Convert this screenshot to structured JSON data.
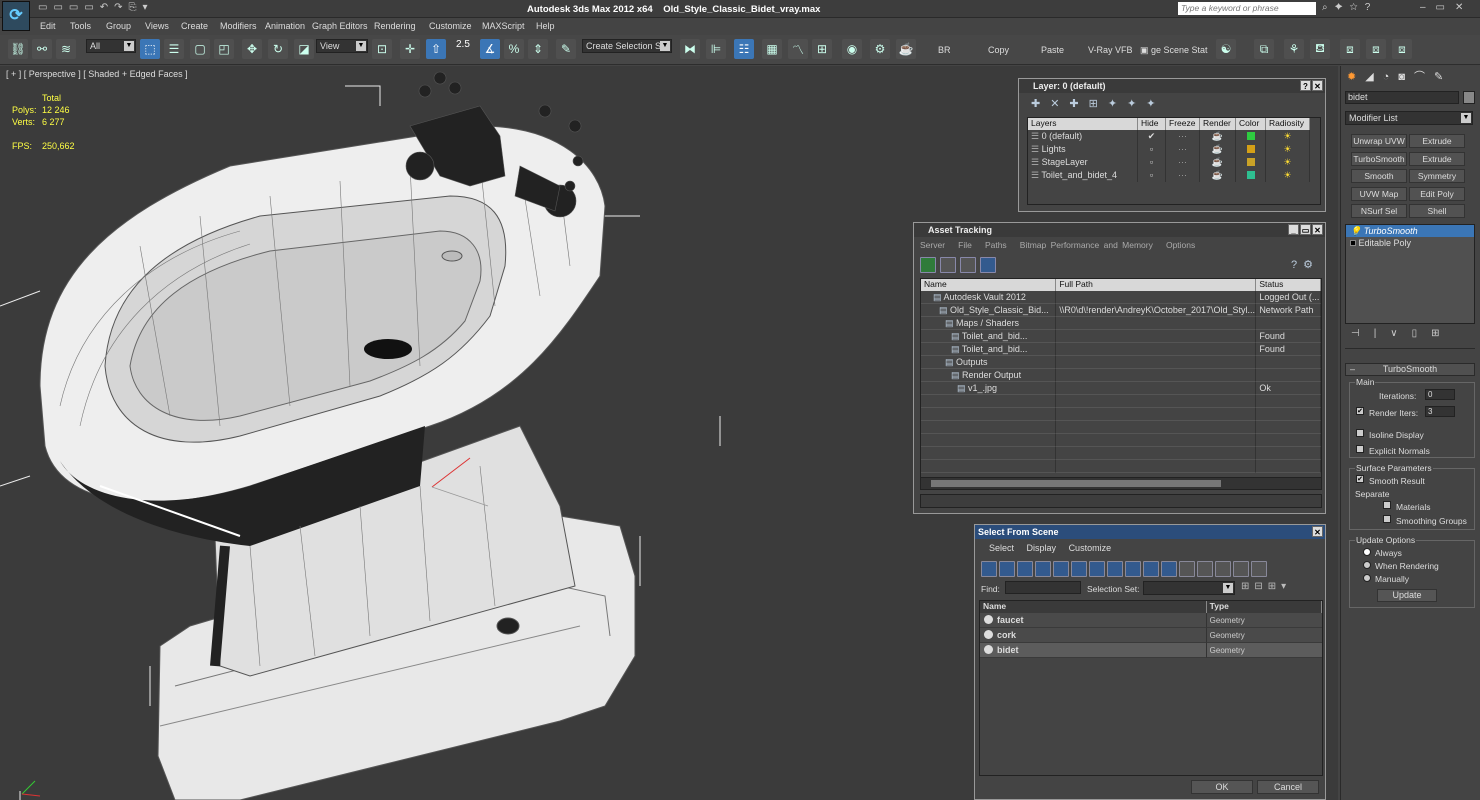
{
  "titlebar": {
    "app": "Autodesk 3ds Max  2012 x64",
    "file": "Old_Style_Classic_Bidet_vray.max",
    "search_placeholder": "Type a keyword or phrase"
  },
  "menu": [
    "Edit",
    "Tools",
    "Group",
    "Views",
    "Create",
    "Modifiers",
    "Animation",
    "Graph Editors",
    "Rendering",
    "Customize",
    "MAXScript",
    "Help"
  ],
  "toolbar": {
    "filter": "All",
    "refcoord": "View",
    "snap": "2.5",
    "selset": "Create Selection Se",
    "br": "BR",
    "copy": "Copy",
    "paste": "Paste",
    "vfb": "V-Ray VFB",
    "scene_state": "ge Scene Stat"
  },
  "viewport": {
    "label": "[ + ] [ Perspective ] [ Shaded + Edged Faces ]",
    "stats": {
      "total": "Total",
      "polys_label": "Polys:",
      "polys": "12 246",
      "verts_label": "Verts:",
      "verts": "6 277",
      "fps_label": "FPS:",
      "fps": "250,662"
    }
  },
  "layer_window": {
    "title": "Layer: 0 (default)",
    "cols": [
      "Layers",
      "Hide",
      "Freeze",
      "Render",
      "Color",
      "Radiosity"
    ],
    "rows": [
      {
        "name": "0 (default)",
        "color": "#2ecc40"
      },
      {
        "name": "Lights",
        "color": "#d4a017"
      },
      {
        "name": "StageLayer",
        "color": "#c9a227"
      },
      {
        "name": "Toilet_and_bidet_4",
        "color": "#2ebf91"
      }
    ]
  },
  "asset_window": {
    "title": "Asset Tracking",
    "menu": [
      "Server",
      "File",
      "Paths",
      "Bitmap Performance and Memory",
      "Options"
    ],
    "cols": [
      "Name",
      "Full Path",
      "Status"
    ],
    "rows": [
      {
        "indent": 2,
        "name": "Autodesk Vault 2012",
        "path": "",
        "status": "Logged Out (..."
      },
      {
        "indent": 3,
        "name": "Old_Style_Classic_Bid...",
        "path": "\\\\R0\\d\\!render\\AndreyK\\October_2017\\Old_Styl...",
        "status": "Network Path"
      },
      {
        "indent": 4,
        "name": "Maps / Shaders",
        "path": "",
        "status": ""
      },
      {
        "indent": 5,
        "name": "Toilet_and_bid...",
        "path": "",
        "status": "Found"
      },
      {
        "indent": 5,
        "name": "Toilet_and_bid...",
        "path": "",
        "status": "Found"
      },
      {
        "indent": 4,
        "name": "Outputs",
        "path": "",
        "status": ""
      },
      {
        "indent": 5,
        "name": "Render Output",
        "path": "",
        "status": ""
      },
      {
        "indent": 6,
        "name": "v1_.jpg",
        "path": "",
        "status": "Ok"
      }
    ]
  },
  "select_window": {
    "title": "Select From Scene",
    "menu": [
      "Select",
      "Display",
      "Customize"
    ],
    "find_label": "Find:",
    "selset_label": "Selection Set:",
    "cols": [
      "Name",
      "Type"
    ],
    "rows": [
      {
        "name": "faucet",
        "type": "Geometry"
      },
      {
        "name": "cork",
        "type": "Geometry"
      },
      {
        "name": "bidet",
        "type": "Geometry"
      }
    ],
    "ok": "OK",
    "cancel": "Cancel"
  },
  "cmd": {
    "objname": "bidet",
    "modlist": "Modifier List",
    "buttons": [
      "Unwrap UVW",
      "Extrude",
      "TurboSmooth",
      "Extrude",
      "Smooth",
      "Symmetry",
      "UVW Map",
      "Edit Poly",
      "NSurf Sel",
      "Shell"
    ],
    "stack": [
      "TurboSmooth",
      "Editable Poly"
    ],
    "rollout_title": "TurboSmooth",
    "main": "Main",
    "iterations_label": "Iterations:",
    "iterations": "0",
    "render_iters_label": "Render Iters:",
    "render_iters": "3",
    "isoline": "Isoline Display",
    "explicit": "Explicit Normals",
    "surface": "Surface Parameters",
    "smooth_result": "Smooth Result",
    "separate": "Separate",
    "materials": "Materials",
    "smoothing": "Smoothing Groups",
    "update_options": "Update Options",
    "always": "Always",
    "when_rendering": "When Rendering",
    "manually": "Manually",
    "update": "Update"
  }
}
